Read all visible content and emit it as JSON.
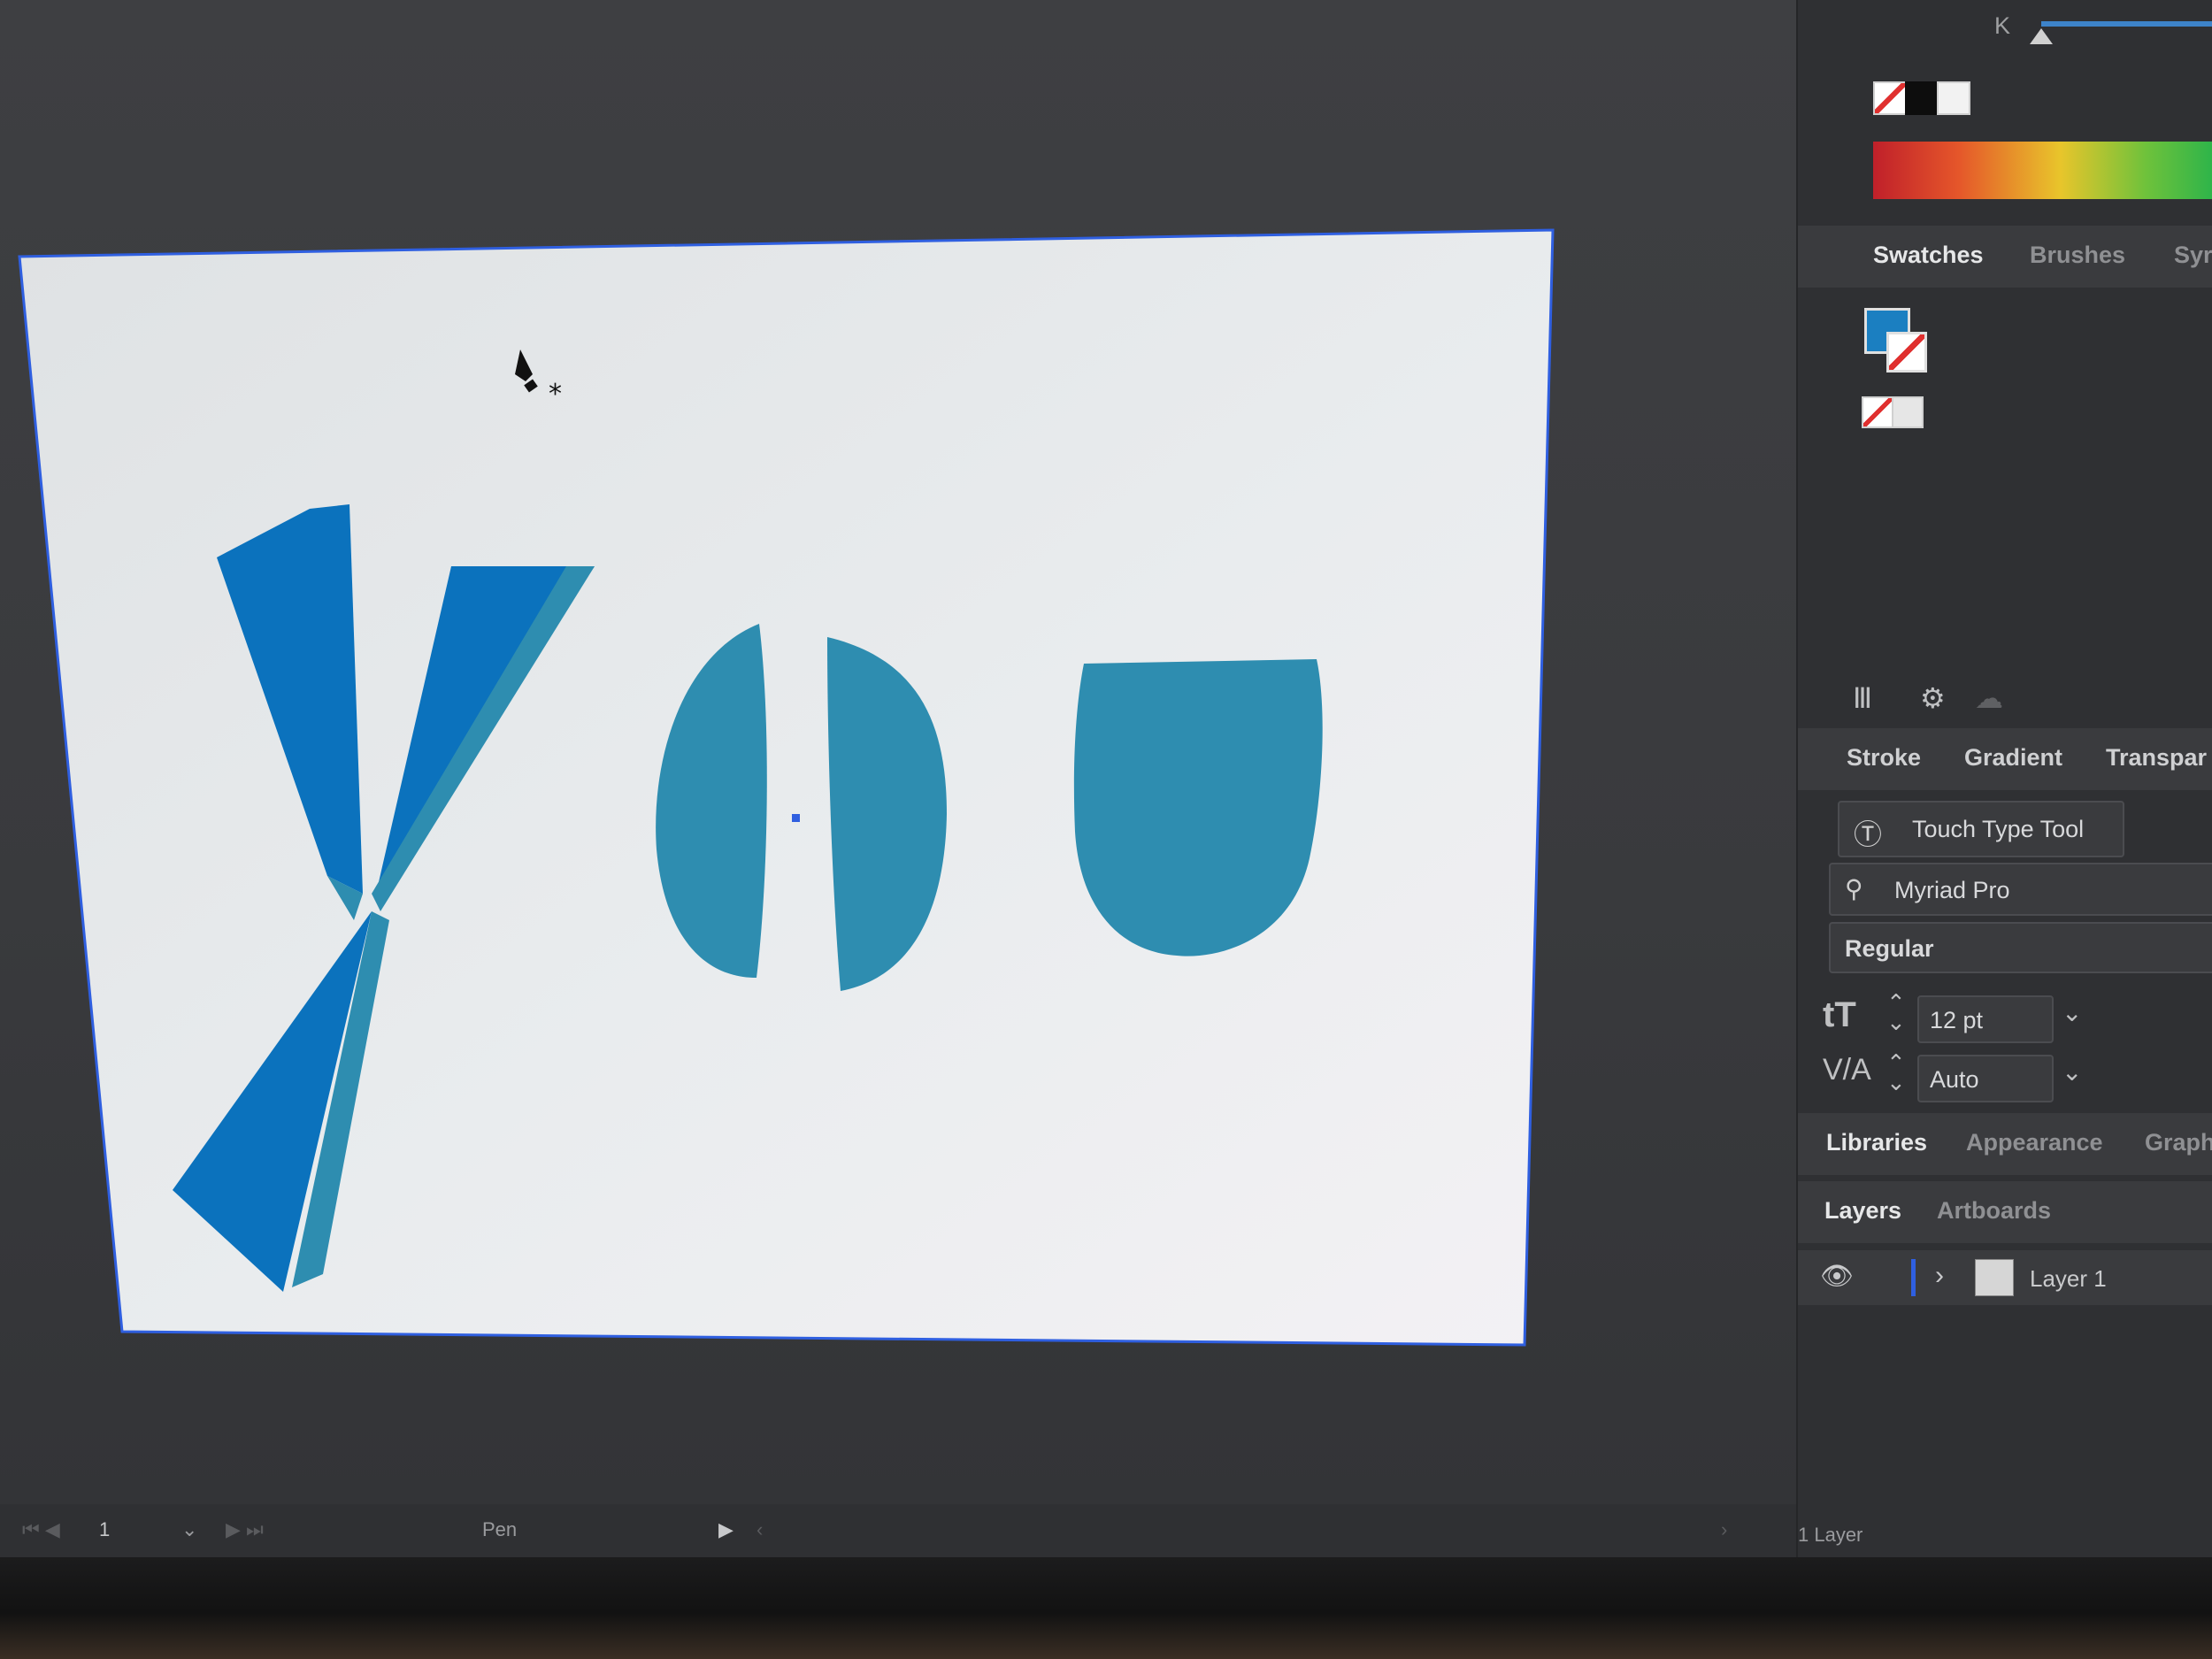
{
  "color_panel": {
    "channel_label": "K",
    "icons": [
      "none-swatch-icon",
      "black-swatch-icon",
      "white-swatch-icon"
    ]
  },
  "swatches_tabs": [
    "Swatches",
    "Brushes",
    "Syr"
  ],
  "swatches": {
    "fill_color": "#1b7fc1",
    "fill_icon": "fill-swatch-icon",
    "stroke_icon": "stroke-none-icon"
  },
  "panel_footer_icons": [
    "libraries-menu-icon",
    "swatch-options-icon",
    "cloud-icon"
  ],
  "properties_tabs": [
    "Stroke",
    "Gradient",
    "Transpar"
  ],
  "character": {
    "touch_type_label": "Touch Type Tool",
    "font_family": "Myriad Pro",
    "font_style": "Regular",
    "font_size": "12 pt",
    "kerning": "Auto"
  },
  "libraries_tabs": [
    "Libraries",
    "Appearance",
    "Graph"
  ],
  "layers_tabs": [
    "Layers",
    "Artboards"
  ],
  "layers": [
    {
      "name": "Layer 1",
      "visible": true
    }
  ],
  "layer_count": "1 Layer",
  "statusbar": {
    "artboard_number": "1",
    "current_tool": "Pen"
  },
  "artwork": {
    "text": "you",
    "fill_dark": "#0b72bd",
    "fill_teal": "#2e8db0"
  }
}
